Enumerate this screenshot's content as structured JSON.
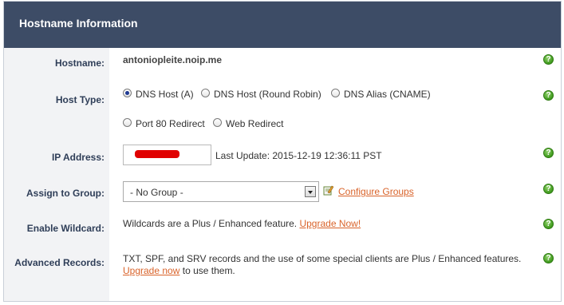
{
  "header": {
    "title": "Hostname Information"
  },
  "labels": {
    "hostname": "Hostname:",
    "host_type": "Host Type:",
    "ip_address": "IP Address:",
    "assign_group": "Assign to Group:",
    "enable_wildcard": "Enable Wildcard:",
    "advanced_records": "Advanced Records:"
  },
  "hostname": {
    "value": "antoniopleite.noip.me"
  },
  "host_type": {
    "options": [
      "DNS Host (A)",
      "DNS Host (Round Robin)",
      "DNS Alias (CNAME)",
      "Port 80 Redirect",
      "Web Redirect"
    ],
    "selected": "DNS Host (A)"
  },
  "ip": {
    "last_update": "Last Update: 2015-12-19 12:36:11 PST"
  },
  "group": {
    "selected": "- No Group -",
    "configure_link": "Configure Groups"
  },
  "wildcard": {
    "text": "Wildcards are a Plus / Enhanced feature.",
    "link": "Upgrade Now!"
  },
  "advanced": {
    "text": "TXT, SPF, and SRV records and the use of some special clients are Plus / Enhanced features.",
    "link": "Upgrade now",
    "suffix": "to use them."
  },
  "help_icon": "question-circle-icon",
  "colors": {
    "header_bg": "#3d4c66",
    "label_text": "#2f3e58",
    "link": "#d9632a",
    "help_green": "#3f9a1d",
    "redaction": "#e00000"
  }
}
